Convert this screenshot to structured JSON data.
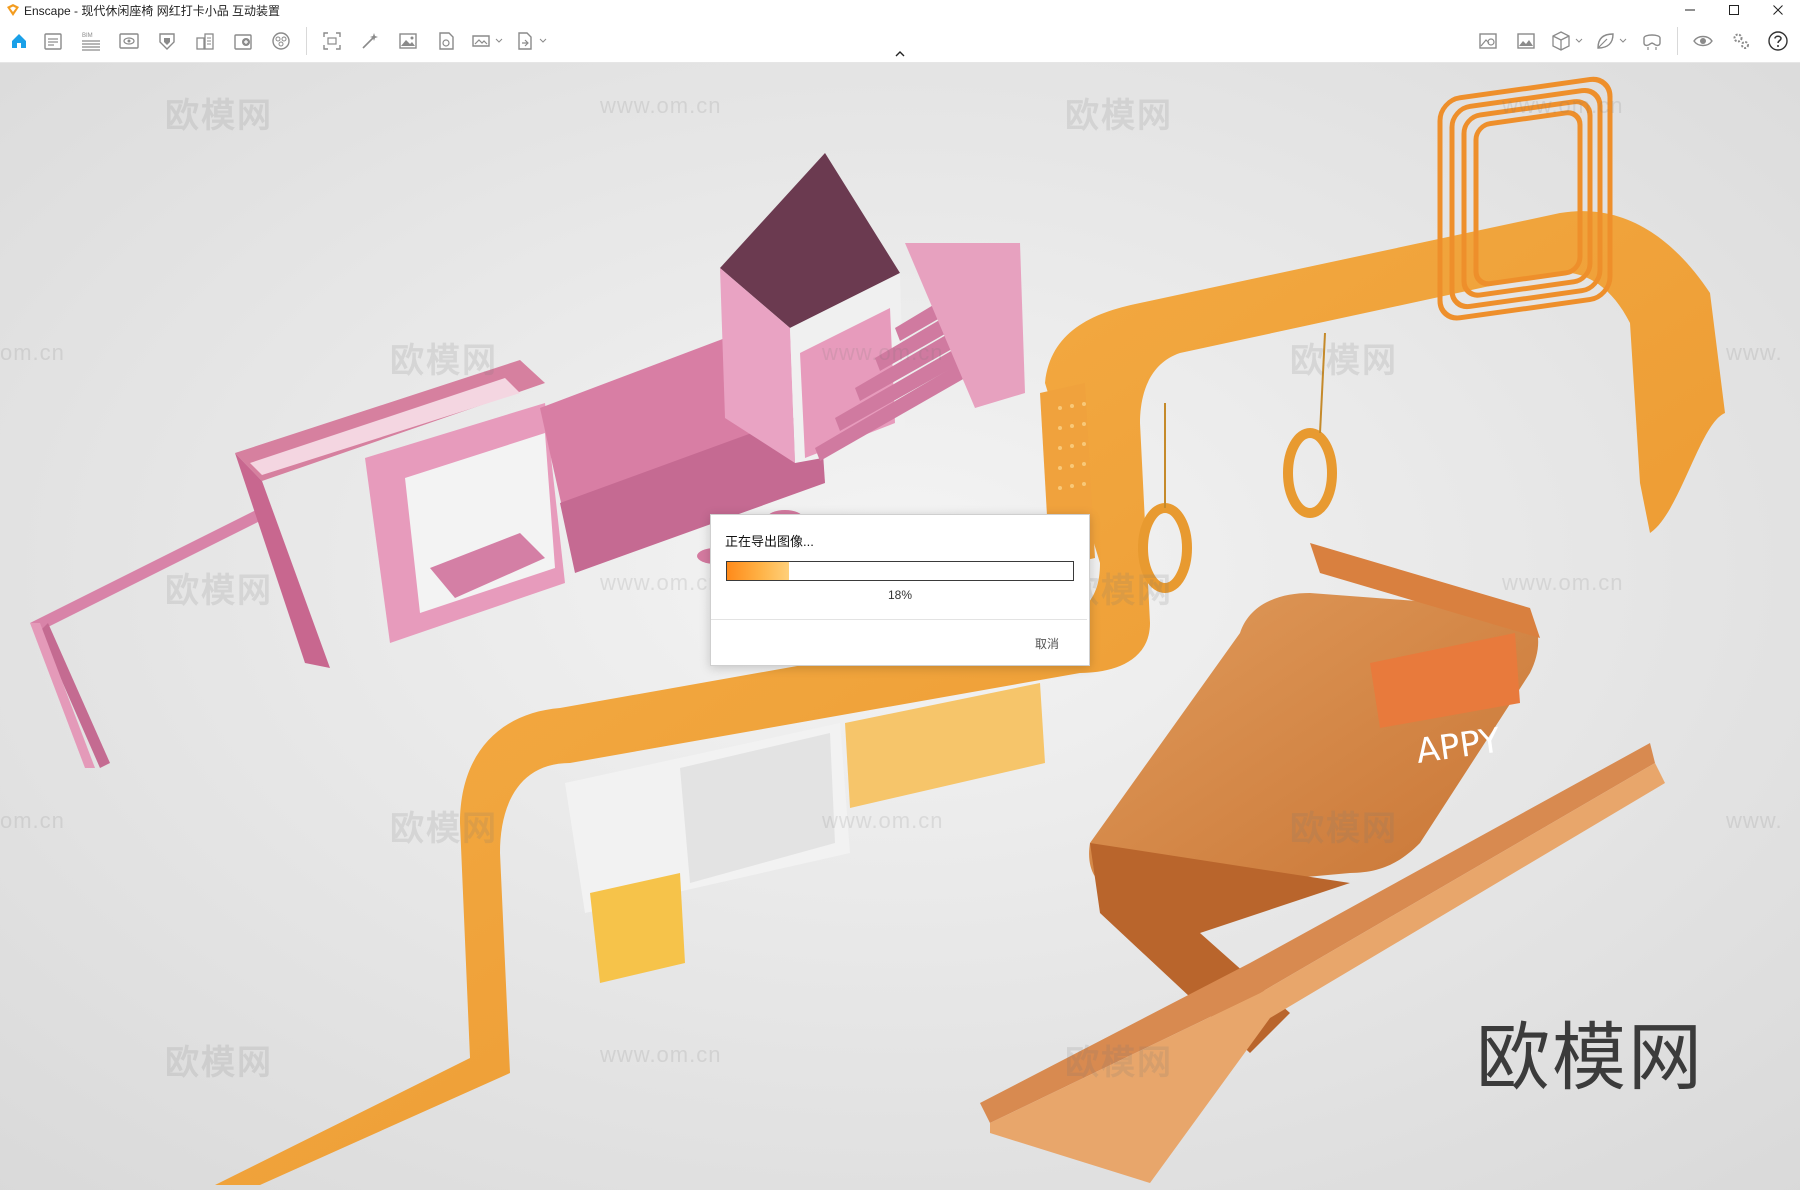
{
  "window": {
    "title": "Enscape - 现代休闲座椅 网红打卡小品 互动装置",
    "controls": [
      "minimize-icon",
      "maximize-icon",
      "close-icon"
    ]
  },
  "toolbar": {
    "left_icons": [
      "home-icon",
      "project-icon",
      "bim-icon",
      "views-icon",
      "clipping-icon",
      "buildings-icon",
      "asset-library-icon",
      "material-icon",
      "screenshot-icon",
      "batch-render-icon",
      "render-image-icon",
      "video-editor-icon",
      "panorama-icon",
      "export-icon"
    ],
    "bim_label": "BIM",
    "right_icons": [
      "visual-settings-icon",
      "atmosphere-icon",
      "cube-icon",
      "leaf-icon",
      "vr-headset-icon",
      "eye-icon",
      "settings-icon",
      "help-icon"
    ]
  },
  "viewport": {
    "watermark_brand": "欧模网",
    "watermark_url": "www.om.cn",
    "watermark_url_partial": "om.cn",
    "watermark_url_cut": "www.",
    "corner_brand": "欧模网",
    "sign_text": "APPY"
  },
  "dialog": {
    "title": "正在导出图像...",
    "progress": 0.18,
    "progress_label": "18%",
    "cancel_label": "取消"
  },
  "colors": {
    "accent": "#1aa0e8",
    "progress_orange": "#ff8a1a",
    "structure_pink": "#d77aa0",
    "structure_orange": "#f2a43a"
  }
}
